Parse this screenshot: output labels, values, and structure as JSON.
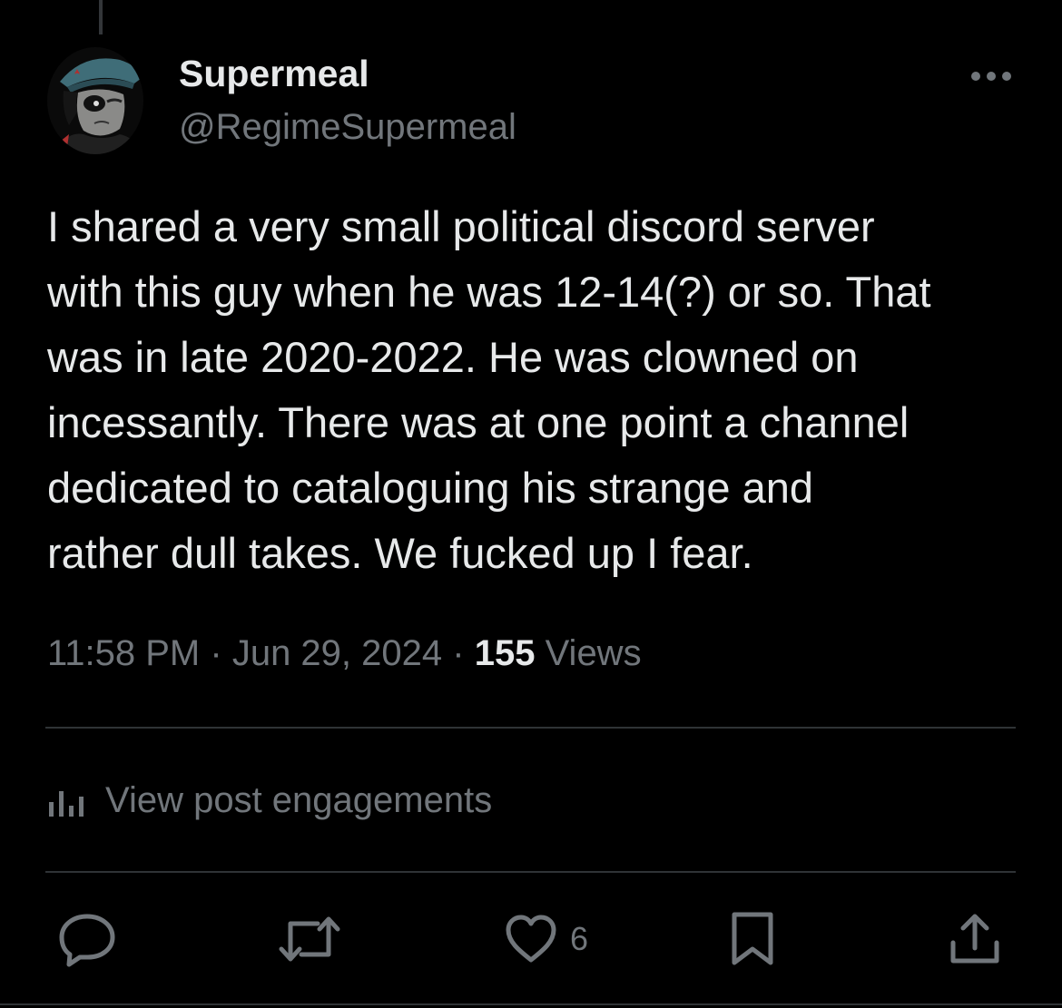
{
  "author": {
    "display_name": "Supermeal",
    "handle": "@RegimeSupermeal"
  },
  "post": {
    "text": "I shared a very small political discord server\nwith this guy when he was 12-14(?) or so. That\nwas in late 2020-2022. He was clowned on\nincessantly. There was at one point a channel\ndedicated to cataloguing his strange and\nrather dull takes. We fucked up I fear.",
    "time": "11:58 PM",
    "separator": "·",
    "date": "Jun 29, 2024",
    "views_count": "155",
    "views_label": "Views"
  },
  "engagements": {
    "label": "View post engagements",
    "icon": "analytics-icon"
  },
  "actions": {
    "reply_icon": "reply-icon",
    "repost_icon": "repost-icon",
    "like_icon": "heart-icon",
    "like_count": "6",
    "bookmark_icon": "bookmark-icon",
    "share_icon": "share-icon"
  },
  "colors": {
    "background": "#000000",
    "primary_text": "#e7e9ea",
    "secondary_text": "#71767b",
    "divider": "#2f3336"
  }
}
